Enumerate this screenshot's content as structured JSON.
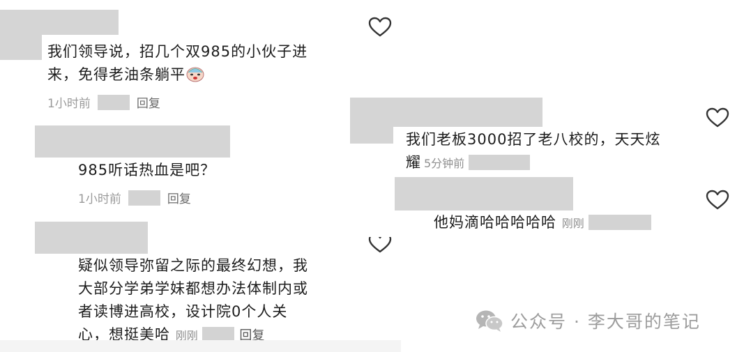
{
  "comments": {
    "c1": {
      "text_line1": "我们领导说，招几个双985的小伙子进",
      "text_line2": "来，免得老油条躺平",
      "time": "1小时前",
      "reply": "回复"
    },
    "c2": {
      "text": "985听话热血是吧？",
      "time": "1小时前",
      "reply": "回复"
    },
    "c3": {
      "line1": "疑似领导弥留之际的最终幻想，我",
      "line2": "大部分学弟学妹都想办法体制内或",
      "line3": "者读博进高校，设计院0个人关",
      "line4": "心，想挺美哈",
      "time": "刚刚",
      "reply": "回复"
    },
    "c4": {
      "line1": "我们老板3000招了老八校的，天天炫",
      "line2": "耀",
      "time": "5分钟前"
    },
    "c5": {
      "text": "他妈滴哈哈哈哈哈",
      "time": "刚刚"
    }
  },
  "watermark": {
    "icon": "wechat-icon",
    "text": "公众号 · 李大哥的笔记"
  },
  "icons": {
    "like": "heart-outline-icon",
    "emoji": "crying-laughing-emoji"
  },
  "colors": {
    "mask": "#d5d5d5",
    "meta": "#8a8a8a",
    "text": "#1c1c1c",
    "watermark": "#9c9c9c"
  }
}
